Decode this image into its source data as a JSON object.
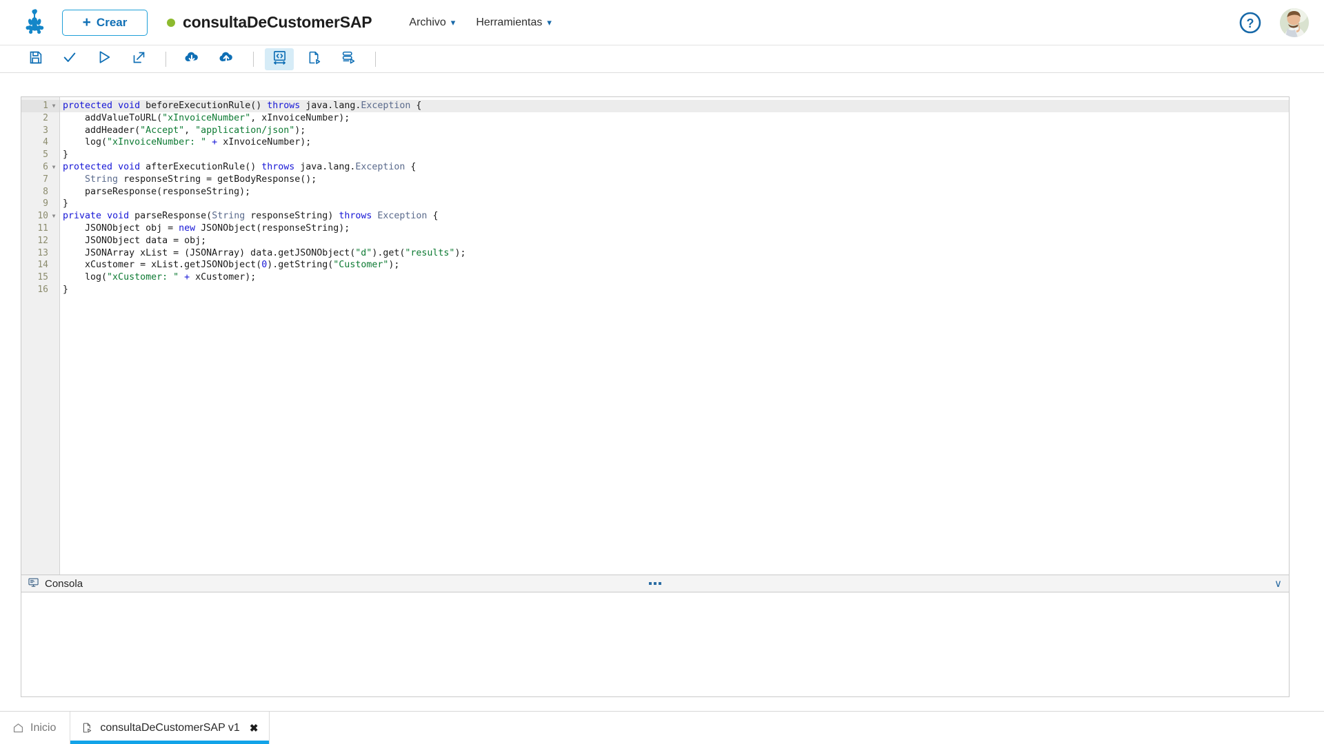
{
  "header": {
    "logo_name": "bizagi-frog-logo",
    "create_label": "Crear",
    "create_plus": "+",
    "document_title": "consultaDeCustomerSAP",
    "status_dot_color": "#8dba2e",
    "menus": [
      {
        "label": "Archivo",
        "chevron": "▾"
      },
      {
        "label": "Herramientas",
        "chevron": "▾"
      }
    ],
    "help_icon": "help-circle-icon",
    "avatar_icon": "user-avatar"
  },
  "toolbar": {
    "buttons": [
      {
        "name": "save-button",
        "icon": "floppy-disk-icon",
        "active": false
      },
      {
        "name": "validate-button",
        "icon": "checkmark-icon",
        "active": false
      },
      {
        "name": "run-button",
        "icon": "play-triangle-icon",
        "active": false
      },
      {
        "name": "open-external-button",
        "icon": "external-link-icon",
        "active": false
      },
      {
        "name": "download-button",
        "icon": "cloud-download-icon",
        "active": false
      },
      {
        "name": "upload-button",
        "icon": "cloud-upload-icon",
        "active": false
      },
      {
        "name": "source-code-button",
        "icon": "code-brackets-icon",
        "active": true
      },
      {
        "name": "document-run-button",
        "icon": "document-play-icon",
        "active": false
      },
      {
        "name": "data-run-button",
        "icon": "database-play-icon",
        "active": false
      }
    ]
  },
  "editor": {
    "current_line": 1,
    "fold_lines": [
      1,
      6,
      10
    ],
    "lines": [
      {
        "n": 1,
        "tokens": [
          {
            "t": "protected",
            "c": "kw"
          },
          {
            "t": " "
          },
          {
            "t": "void",
            "c": "kw"
          },
          {
            "t": " beforeExecutionRule() "
          },
          {
            "t": "throws",
            "c": "kw"
          },
          {
            "t": " java.lang."
          },
          {
            "t": "Exception",
            "c": "typ"
          },
          {
            "t": " {"
          }
        ]
      },
      {
        "n": 2,
        "tokens": [
          {
            "t": "    addValueToURL("
          },
          {
            "t": "\"xInvoiceNumber\"",
            "c": "str"
          },
          {
            "t": ", xInvoiceNumber);"
          }
        ]
      },
      {
        "n": 3,
        "tokens": [
          {
            "t": "    addHeader("
          },
          {
            "t": "\"Accept\"",
            "c": "str"
          },
          {
            "t": ", "
          },
          {
            "t": "\"application/json\"",
            "c": "str"
          },
          {
            "t": ");"
          }
        ]
      },
      {
        "n": 4,
        "tokens": [
          {
            "t": "    log("
          },
          {
            "t": "\"xInvoiceNumber: \"",
            "c": "str"
          },
          {
            "t": " "
          },
          {
            "t": "+",
            "c": "kw"
          },
          {
            "t": " xInvoiceNumber);"
          }
        ]
      },
      {
        "n": 5,
        "tokens": [
          {
            "t": "}"
          }
        ]
      },
      {
        "n": 6,
        "tokens": [
          {
            "t": "protected",
            "c": "kw"
          },
          {
            "t": " "
          },
          {
            "t": "void",
            "c": "kw"
          },
          {
            "t": " afterExecutionRule() "
          },
          {
            "t": "throws",
            "c": "kw"
          },
          {
            "t": " java.lang."
          },
          {
            "t": "Exception",
            "c": "typ"
          },
          {
            "t": " {"
          }
        ]
      },
      {
        "n": 7,
        "tokens": [
          {
            "t": "    "
          },
          {
            "t": "String",
            "c": "typ"
          },
          {
            "t": " responseString = getBodyResponse();"
          }
        ]
      },
      {
        "n": 8,
        "tokens": [
          {
            "t": "    parseResponse(responseString);"
          }
        ]
      },
      {
        "n": 9,
        "tokens": [
          {
            "t": "}"
          }
        ]
      },
      {
        "n": 10,
        "tokens": [
          {
            "t": "private",
            "c": "kw"
          },
          {
            "t": " "
          },
          {
            "t": "void",
            "c": "kw"
          },
          {
            "t": " parseResponse("
          },
          {
            "t": "String",
            "c": "typ"
          },
          {
            "t": " responseString) "
          },
          {
            "t": "throws",
            "c": "kw"
          },
          {
            "t": " "
          },
          {
            "t": "Exception",
            "c": "typ"
          },
          {
            "t": " {"
          }
        ]
      },
      {
        "n": 11,
        "tokens": [
          {
            "t": "    JSONObject obj = "
          },
          {
            "t": "new",
            "c": "kw"
          },
          {
            "t": " JSONObject(responseString);"
          }
        ]
      },
      {
        "n": 12,
        "tokens": [
          {
            "t": "    JSONObject data = obj;"
          }
        ]
      },
      {
        "n": 13,
        "tokens": [
          {
            "t": "    JSONArray xList = (JSONArray) data.getJSONObject("
          },
          {
            "t": "\"d\"",
            "c": "str"
          },
          {
            "t": ").get("
          },
          {
            "t": "\"results\"",
            "c": "str"
          },
          {
            "t": ");"
          }
        ]
      },
      {
        "n": 14,
        "tokens": [
          {
            "t": "    xCustomer = xList.getJSONObject("
          },
          {
            "t": "0",
            "c": "num"
          },
          {
            "t": ").getString("
          },
          {
            "t": "\"Customer\"",
            "c": "str"
          },
          {
            "t": ");"
          }
        ]
      },
      {
        "n": 15,
        "tokens": [
          {
            "t": "    log("
          },
          {
            "t": "\"xCustomer: \"",
            "c": "str"
          },
          {
            "t": " "
          },
          {
            "t": "+",
            "c": "kw"
          },
          {
            "t": " xCustomer);"
          }
        ]
      },
      {
        "n": 16,
        "tokens": [
          {
            "t": "}"
          }
        ]
      }
    ]
  },
  "console": {
    "title": "Consola",
    "icon": "console-monitor-icon",
    "drag_handle": "resize-handle",
    "collapse_chevron": "∨",
    "content": ""
  },
  "tabbar": {
    "home_label": "Inicio",
    "home_icon": "home-icon",
    "document_tab_label": "consultaDeCustomerSAP v1",
    "document_tab_icon": "document-run-icon",
    "close_glyph": "✖"
  }
}
